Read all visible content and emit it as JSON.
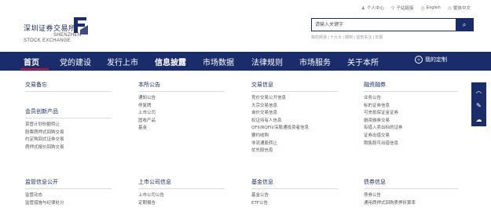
{
  "logo": {
    "cn": "深圳证券交易所",
    "en1": "SHENZHEN",
    "en2": "STOCK EXCHANGE"
  },
  "toplinks": [
    {
      "icon": "person-icon",
      "label": "个人中心"
    },
    {
      "icon": "link-icon",
      "label": "子站链接"
    },
    {
      "icon": "globe-icon",
      "label": "English"
    },
    {
      "icon": "globe-icon",
      "label": "繁体中文"
    }
  ],
  "search": {
    "placeholder": "请输入关键字",
    "hot": "我的频道 | 十九大 | 期权 | 监管关注 | 年报"
  },
  "nav": {
    "items": [
      "首页",
      "党的建设",
      "发行上市",
      "信息披露",
      "市场数据",
      "法律规则",
      "市场服务",
      "关于本所"
    ],
    "custom": "我的定制",
    "active_index": 0
  },
  "columns": [
    {
      "title": "交易备忘",
      "links": []
    },
    {
      "title": "本所公告",
      "links": [
        "通知公告",
        "停复牌",
        "上市公司",
        "固收产品",
        "基金"
      ]
    },
    {
      "title": "交易信息",
      "links": [
        "竞价交易公开信息",
        "大宗交易信息",
        "询价交易信息",
        "权证持有人信息",
        "QFII/RQFII/深股通投资者信息",
        "要约收购",
        "非流通股转让",
        "优先股信息"
      ]
    },
    {
      "title": "融资融券",
      "links": [
        "业务公告",
        "标的证券信息",
        "可充抵保证金证券",
        "融资融券交易",
        "有借入卖出标的证券",
        "证券出借交易",
        "限售股可出借信息"
      ]
    }
  ],
  "extra_column": {
    "title": "会员创新产品",
    "links": [
      "资管计划份额转让",
      "股票质押式回购交易",
      "约定购回式证券交易",
      "质押式报价回购交易"
    ]
  },
  "bottom_columns": [
    {
      "title": "监管信息公开",
      "links": [
        "监管动态",
        "监管措施与纪律处分"
      ]
    },
    {
      "title": "上市公司信息",
      "links": [
        "上市公司公告",
        "定期报告"
      ]
    },
    {
      "title": "基金信息",
      "links": [
        "基金公告",
        "ETF公告"
      ]
    },
    {
      "title": "债券信息",
      "links": [
        "债券公告",
        "通用质押式回购质押折算率"
      ]
    }
  ],
  "side_icons": [
    "chevron-up-icon",
    "edit-icon",
    "chat-icon"
  ],
  "colors": {
    "brand": "#1b2c6b",
    "accent": "#c8102e"
  }
}
